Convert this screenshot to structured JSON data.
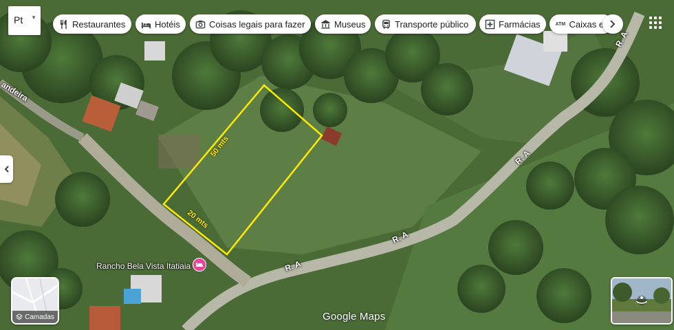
{
  "search": {
    "text": "Pt"
  },
  "chips": [
    {
      "label": "Restaurantes",
      "icon": "fork-knife-icon"
    },
    {
      "label": "Hotéis",
      "icon": "bed-icon"
    },
    {
      "label": "Coisas legais para fazer",
      "icon": "camera-icon"
    },
    {
      "label": "Museus",
      "icon": "museum-icon"
    },
    {
      "label": "Transporte público",
      "icon": "bus-icon"
    },
    {
      "label": "Farmácias",
      "icon": "pharmacy-icon"
    },
    {
      "label": "Caixas el",
      "icon": "atm-icon"
    }
  ],
  "atm_tag": "ATM",
  "map": {
    "road_labels": [
      "R. A",
      "R. A",
      "R. A",
      "R. A",
      "andeira"
    ],
    "poi": {
      "name": "Rancho Bela Vista Itatiaia",
      "icon": "hotel-pin-icon"
    },
    "measurements": [
      "50 mts",
      "20 mts"
    ],
    "highlight_color": "#ffeb00"
  },
  "layers": {
    "label": "Camadas"
  },
  "branding": "Google Maps"
}
